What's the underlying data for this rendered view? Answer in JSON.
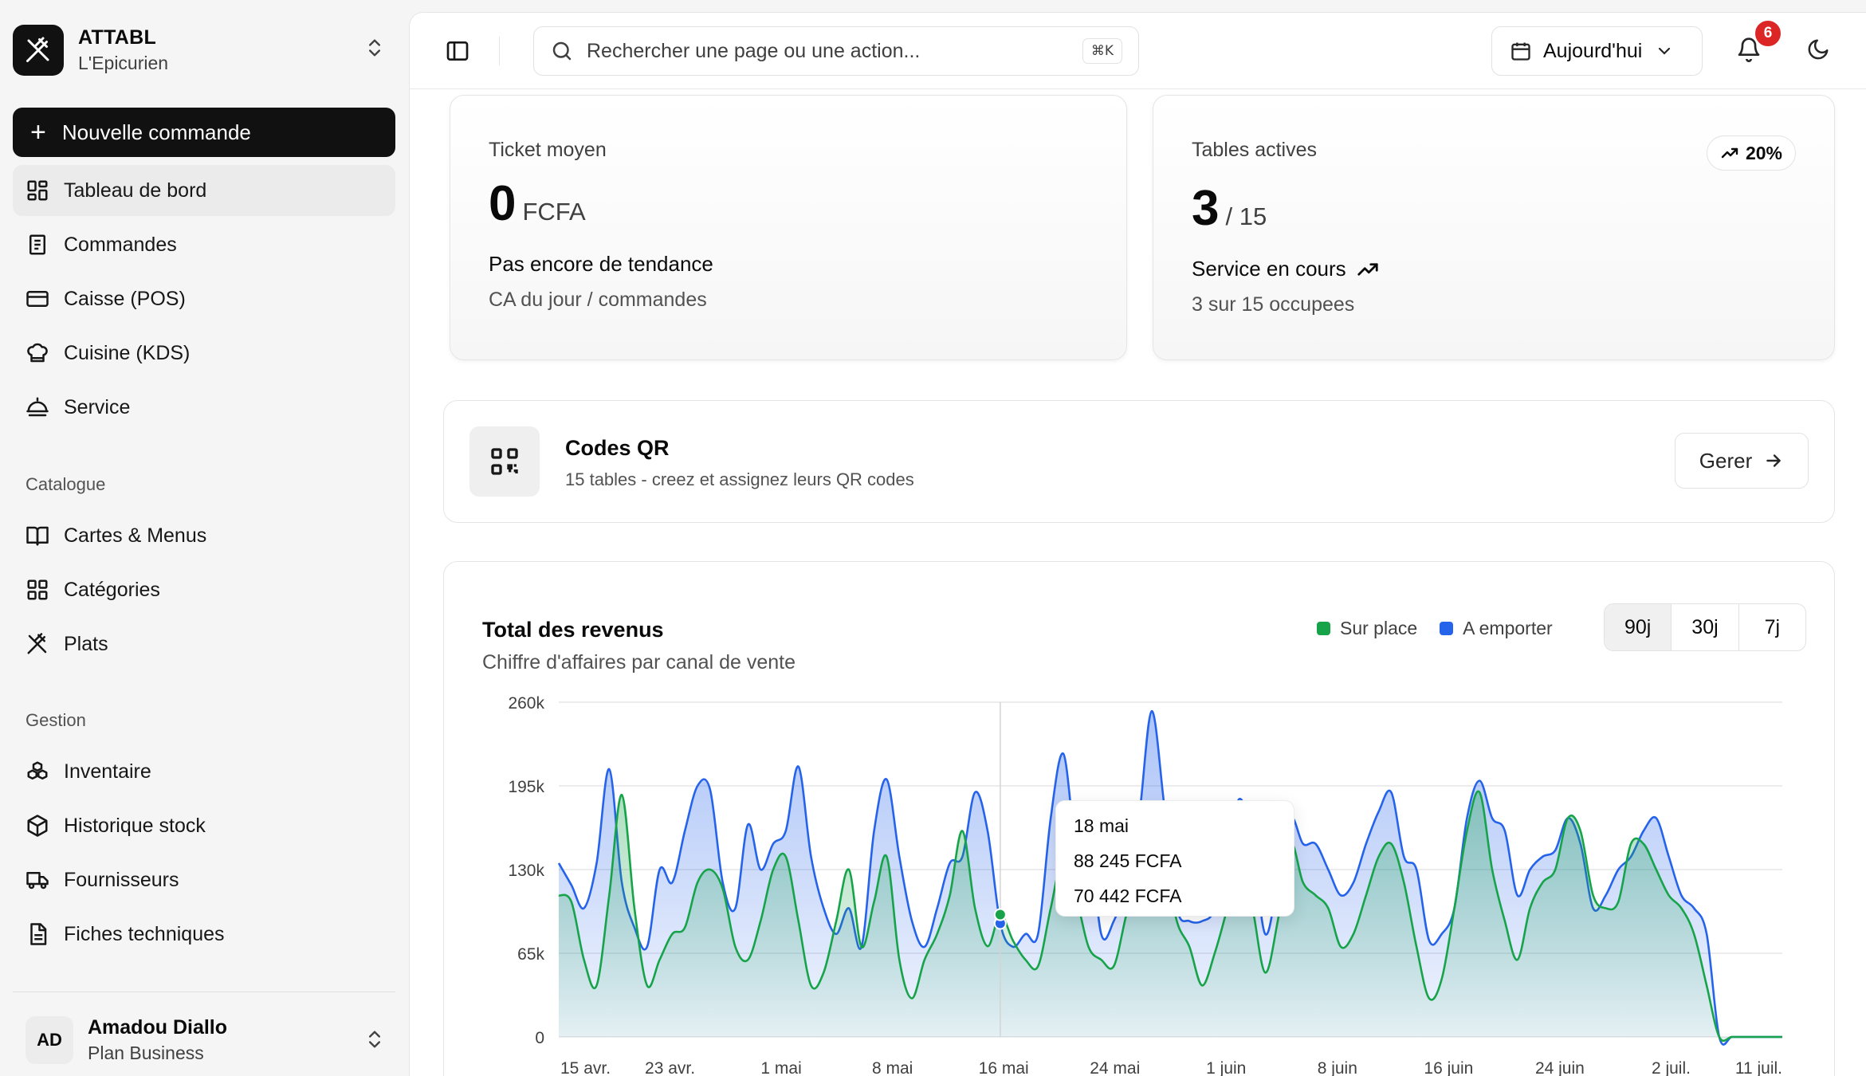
{
  "brand": {
    "name": "ATTABL",
    "sub": "L'Epicurien"
  },
  "sidebar": {
    "new_order": "Nouvelle commande",
    "main_items": [
      {
        "label": "Tableau de bord",
        "icon": "dashboard-icon",
        "active": true
      },
      {
        "label": "Commandes",
        "icon": "receipt-icon"
      },
      {
        "label": "Caisse (POS)",
        "icon": "card-icon"
      },
      {
        "label": "Cuisine (KDS)",
        "icon": "chef-hat-icon"
      },
      {
        "label": "Service",
        "icon": "cloche-icon"
      }
    ],
    "catalogue_title": "Catalogue",
    "catalogue_items": [
      {
        "label": "Cartes & Menus",
        "icon": "book-icon"
      },
      {
        "label": "Catégories",
        "icon": "grid-icon"
      },
      {
        "label": "Plats",
        "icon": "utensils-icon"
      }
    ],
    "gestion_title": "Gestion",
    "gestion_items": [
      {
        "label": "Inventaire",
        "icon": "boxes-icon"
      },
      {
        "label": "Historique stock",
        "icon": "package-icon"
      },
      {
        "label": "Fournisseurs",
        "icon": "truck-icon"
      },
      {
        "label": "Fiches techniques",
        "icon": "file-text-icon"
      }
    ]
  },
  "user": {
    "initials": "AD",
    "name": "Amadou Diallo",
    "plan": "Plan Business"
  },
  "topbar": {
    "search_placeholder": "Rechercher une page ou une action...",
    "shortcut": "⌘K",
    "date_label": "Aujourd'hui",
    "notifications": "6"
  },
  "stats": {
    "ticket": {
      "label": "Ticket moyen",
      "value": "0",
      "unit": "FCFA",
      "trend": "Pas encore de tendance",
      "foot": "CA du jour / commandes"
    },
    "tables": {
      "label": "Tables actives",
      "value": "3",
      "unit": "/ 15",
      "badge": "20%",
      "trend": "Service en cours",
      "foot": "3 sur 15 occupees"
    }
  },
  "qr": {
    "title": "Codes QR",
    "sub": "15 tables - creez et assignez leurs QR codes",
    "button": "Gerer"
  },
  "revenue": {
    "title": "Total des revenus",
    "sub": "Chiffre d'affaires par canal de vente",
    "ranges": [
      "90j",
      "30j",
      "7j"
    ],
    "tooltip": {
      "date": "18 mai",
      "a": "88 245 FCFA",
      "b": "70 442 FCFA"
    }
  },
  "colors": {
    "sur_place": "#16a34a",
    "a_emporter": "#2563eb"
  },
  "chart_data": {
    "type": "area",
    "xlabel": "",
    "ylabel": "",
    "ylim": [
      0,
      260000
    ],
    "y_ticks": [
      "0",
      "65k",
      "130k",
      "195k",
      "260k"
    ],
    "x_ticks": [
      "15 avr.",
      "23 avr.",
      "1 mai",
      "8 mai",
      "16 mai",
      "24 mai",
      "1 juin",
      "8 juin",
      "16 juin",
      "24 juin",
      "2 juil.",
      "11 juil."
    ],
    "legend": "top-right",
    "grid": true,
    "x_start": "15 avr.",
    "series": [
      {
        "name": "A emporter",
        "color": "#2563eb",
        "values": [
          135000,
          118000,
          100000,
          135000,
          208000,
          120000,
          85000,
          70000,
          130000,
          120000,
          160000,
          195000,
          192000,
          120000,
          100000,
          165000,
          130000,
          150000,
          160000,
          210000,
          140000,
          100000,
          80000,
          100000,
          70000,
          160000,
          200000,
          140000,
          90000,
          70000,
          100000,
          135000,
          140000,
          190000,
          160000,
          88245,
          70000,
          80000,
          80000,
          170000,
          220000,
          150000,
          160000,
          80000,
          90000,
          120000,
          170000,
          253000,
          180000,
          100000,
          90000,
          90000,
          100000,
          150000,
          185000,
          150000,
          80000,
          120000,
          170000,
          150000,
          150000,
          130000,
          110000,
          120000,
          150000,
          175000,
          190000,
          140000,
          130000,
          75000,
          80000,
          100000,
          170000,
          199000,
          170000,
          160000,
          110000,
          130000,
          140000,
          145000,
          170000,
          150000,
          100000,
          110000,
          130000,
          140000,
          160000,
          170000,
          140000,
          110000,
          100000,
          80000,
          0,
          0,
          0,
          0,
          0,
          0
        ]
      },
      {
        "name": "Sur place",
        "color": "#16a34a",
        "values": [
          110000,
          105000,
          60000,
          40000,
          110000,
          188000,
          100000,
          40000,
          60000,
          80000,
          85000,
          120000,
          130000,
          115000,
          70000,
          60000,
          90000,
          130000,
          140000,
          90000,
          40000,
          50000,
          90000,
          130000,
          70000,
          105000,
          140000,
          60000,
          30000,
          60000,
          80000,
          110000,
          160000,
          100000,
          70442,
          95000,
          75000,
          60000,
          55000,
          100000,
          140000,
          110000,
          70000,
          60000,
          55000,
          95000,
          130000,
          170000,
          140000,
          90000,
          70000,
          40000,
          65000,
          100000,
          140000,
          100000,
          50000,
          90000,
          150000,
          120000,
          110000,
          100000,
          70000,
          80000,
          110000,
          140000,
          150000,
          120000,
          70000,
          30000,
          45000,
          100000,
          160000,
          190000,
          130000,
          90000,
          60000,
          100000,
          120000,
          130000,
          170000,
          160000,
          110000,
          100000,
          105000,
          150000,
          150000,
          130000,
          110000,
          100000,
          80000,
          40000,
          0,
          0,
          0,
          0,
          0,
          0
        ]
      }
    ]
  }
}
